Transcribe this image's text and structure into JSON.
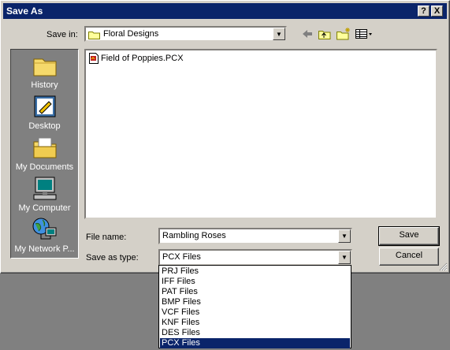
{
  "window": {
    "title": "Save As",
    "help_label": "?",
    "close_label": "X"
  },
  "save_in": {
    "label": "Save in:",
    "value": "Floral Designs"
  },
  "places": [
    {
      "label": "History",
      "icon": "history-icon"
    },
    {
      "label": "Desktop",
      "icon": "desktop-icon"
    },
    {
      "label": "My Documents",
      "icon": "my-documents-icon"
    },
    {
      "label": "My Computer",
      "icon": "my-computer-icon"
    },
    {
      "label": "My Network P...",
      "icon": "my-network-places-icon"
    }
  ],
  "files": [
    {
      "name": "Field of Poppies.PCX",
      "icon": "pcx-file-icon"
    }
  ],
  "file_name": {
    "label": "File name:",
    "value": "Rambling Roses"
  },
  "save_as_type": {
    "label": "Save as type:",
    "value": "PCX Files",
    "options": [
      "PRJ Files",
      "IFF Files",
      "PAT Files",
      "BMP Files",
      "VCF Files",
      "KNF Files",
      "DES Files",
      "PCX Files"
    ],
    "selected_index": 7
  },
  "buttons": {
    "save": "Save",
    "cancel": "Cancel"
  },
  "colors": {
    "title_bar": "#0a246a",
    "face": "#d4d0c8",
    "places_bar": "#808080",
    "selection": "#0a246a"
  }
}
